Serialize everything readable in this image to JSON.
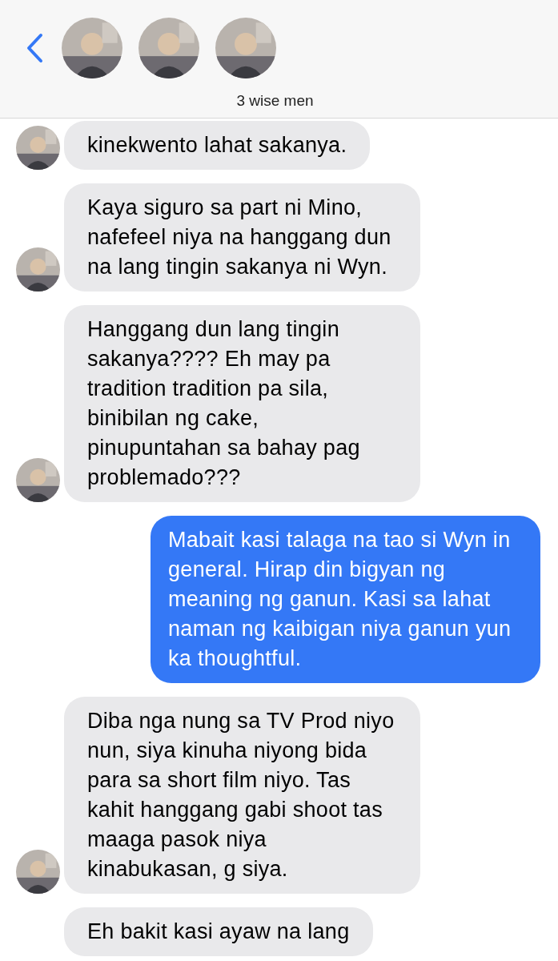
{
  "header": {
    "group_name": "3 wise men"
  },
  "messages": [
    {
      "kind": "received",
      "show_avatar": true,
      "text": "kinekwento lahat sakanya."
    },
    {
      "kind": "received",
      "show_avatar": true,
      "text": "Kaya siguro sa part ni Mino, nafefeel niya na hanggang dun na lang tingin sakanya ni Wyn."
    },
    {
      "kind": "received",
      "show_avatar": true,
      "text": "Hanggang dun lang tingin sakanya???? Eh may pa tradition tradition pa sila, binibilan ng cake, pinupuntahan sa bahay pag problemado???"
    },
    {
      "kind": "sent",
      "text": "Mabait kasi talaga na tao si Wyn in general. Hirap din bigyan ng meaning ng ganun. Kasi sa lahat naman ng kaibigan niya ganun yun ka thoughtful."
    },
    {
      "kind": "received",
      "show_avatar": true,
      "text": "Diba nga nung sa TV Prod niyo nun, siya kinuha niyong bida para sa short film niyo. Tas kahit hanggang gabi shoot tas maaga pasok niya kinabukasan, g siya."
    },
    {
      "kind": "received",
      "show_avatar": false,
      "text": "Eh bakit kasi ayaw na lang"
    }
  ]
}
